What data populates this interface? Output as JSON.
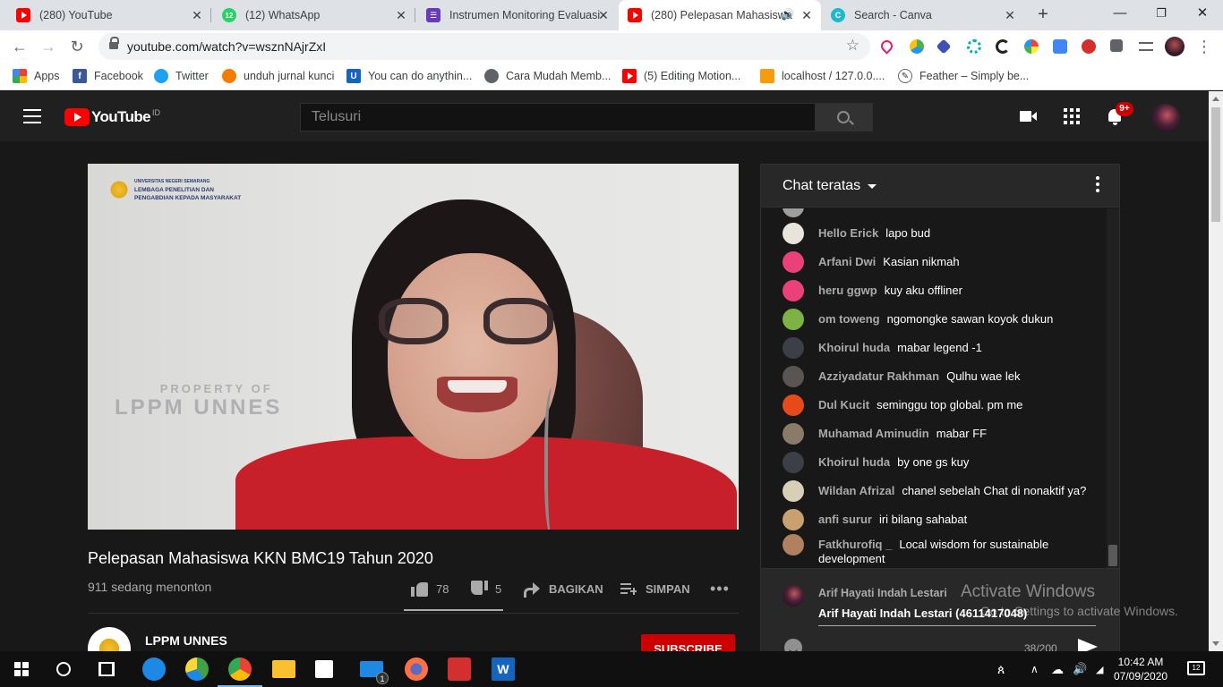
{
  "browser": {
    "tabs": [
      {
        "title": "(280) YouTube",
        "icon": "youtube-icon",
        "active": false
      },
      {
        "title": "(12) WhatsApp",
        "icon": "whatsapp-icon",
        "active": false
      },
      {
        "title": "Instrumen Monitoring Evaluasi",
        "icon": "google-forms-icon",
        "active": false
      },
      {
        "title": "(280) Pelepasan Mahasiswa",
        "icon": "youtube-icon",
        "active": true
      },
      {
        "title": "Search - Canva",
        "icon": "canva-icon",
        "active": false
      }
    ],
    "url": "youtube.com/watch?v=wsznNAjrZxI",
    "bookmarks": [
      {
        "label": "Apps",
        "icon": "apps-grid-icon"
      },
      {
        "label": "Facebook",
        "icon": "facebook-icon"
      },
      {
        "label": "Twitter",
        "icon": "twitter-icon"
      },
      {
        "label": "unduh jurnal kunci",
        "icon": "eye-icon"
      },
      {
        "label": "You can do anythin...",
        "icon": "u-logo-icon"
      },
      {
        "label": "Cara Mudah Memb...",
        "icon": "globe-icon"
      },
      {
        "label": "(5) Editing Motion...",
        "icon": "youtube-icon"
      },
      {
        "label": "localhost / 127.0.0....",
        "icon": "phpmyadmin-icon"
      },
      {
        "label": "Feather – Simply be...",
        "icon": "feather-icon"
      }
    ]
  },
  "youtube": {
    "logo_text": "YouTube",
    "region": "ID",
    "search_placeholder": "Telusuri",
    "notification_count": "9+"
  },
  "video": {
    "title": "Pelepasan Mahasiswa KKN BMC19 Tahun 2020",
    "views": "911 sedang menonton",
    "likes": "78",
    "dislikes": "5",
    "like_ratio": 0.94,
    "share_label": "BAGIKAN",
    "save_label": "SIMPAN",
    "overlay_logo_lines": [
      "UNIVERSITAS NEGERI SEMARANG",
      "LEMBAGA PENELITIAN DAN",
      "PENGABDIAN KEPADA MASYARAKAT"
    ],
    "watermark_line1": "PROPERTY OF",
    "watermark_line2": "LPPM UNNES"
  },
  "channel": {
    "name": "LPPM UNNES",
    "subscribe_label": "SUBSCRIBE"
  },
  "chat": {
    "header": "Chat teratas",
    "messages": [
      {
        "author": "Hello Erick",
        "text": "lapo bud",
        "avatar_color": "#e8e4dc"
      },
      {
        "author": "Arfani Dwi",
        "text": "Kasian nikmah",
        "avatar_color": "#ec407a"
      },
      {
        "author": "heru ggwp",
        "text": "kuy aku offliner",
        "avatar_color": "#ec407a"
      },
      {
        "author": "om toweng",
        "text": "ngomongke sawan koyok dukun",
        "avatar_color": "#7cb342"
      },
      {
        "author": "Khoirul huda",
        "text": "mabar legend -1",
        "avatar_color": "#3a3f48"
      },
      {
        "author": "Azziyadatur Rakhman",
        "text": "Qulhu wae lek",
        "avatar_color": "#5a5550"
      },
      {
        "author": "Dul Kucit",
        "text": "seminggu top global. pm me",
        "avatar_color": "#e64a19"
      },
      {
        "author": "Muhamad Aminudin",
        "text": "mabar FF",
        "avatar_color": "#8a7a6a"
      },
      {
        "author": "Khoirul huda",
        "text": "by one gs kuy",
        "avatar_color": "#3a3f48"
      },
      {
        "author": "Wildan Afrizal",
        "text": "chanel sebelah Chat di nonaktif ya?",
        "avatar_color": "#d8cfb8"
      },
      {
        "author": "anfi surur",
        "text": "iri bilang sahabat",
        "avatar_color": "#c9a070"
      },
      {
        "author": "Fatkhurofiq _",
        "text": "Local wisdom for sustainable development",
        "avatar_color": "#b08060"
      }
    ],
    "input_author": "Arif Hayati Indah Lestari",
    "input_value": "Arif Hayati Indah Lestari (4611417048)",
    "char_counter": "38/200"
  },
  "watermark": {
    "line1": "Activate Windows",
    "line2": "Go to Settings to activate Windows."
  },
  "taskbar": {
    "time": "10:42 AM",
    "date": "07/09/2020",
    "notification_count": "12",
    "mail_badge": "1"
  }
}
